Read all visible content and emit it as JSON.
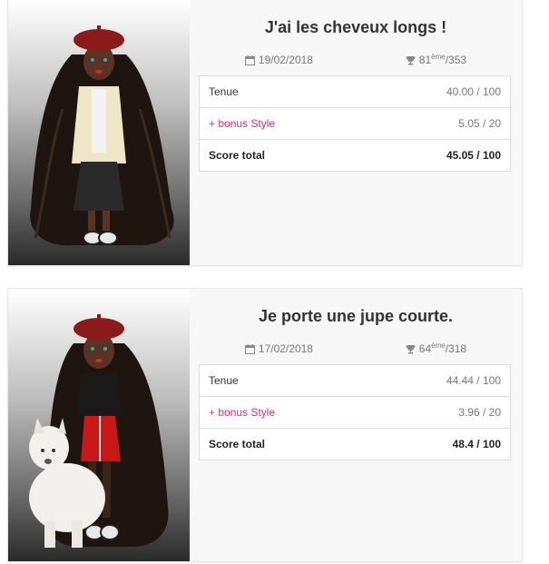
{
  "entries": [
    {
      "title": "J'ai les cheveux longs !",
      "date": "19/02/2018",
      "rank": "81",
      "rank_suffix": "ème",
      "rank_total": "/353",
      "rows": {
        "outfit_label": "Tenue",
        "outfit_value": "40.00 / 100",
        "bonus_label": "+ bonus Style",
        "bonus_value": "5.05 / 20",
        "total_label": "Score total",
        "total_value": "45.05 / 100"
      },
      "avatar": "girl-avatar-long-hair-cream-jacket"
    },
    {
      "title": "Je porte une jupe courte.",
      "date": "17/02/2018",
      "rank": "64",
      "rank_suffix": "ème",
      "rank_total": "/318",
      "rows": {
        "outfit_label": "Tenue",
        "outfit_value": "44.44 / 100",
        "bonus_label": "+ bonus Style",
        "bonus_value": "3.96 / 20",
        "total_label": "Score total",
        "total_value": "48.4 / 100"
      },
      "avatar": "girl-avatar-red-skirt-white-dog"
    }
  ],
  "colors": {
    "bonus": "#e0297a",
    "card_bg": "#f7f7f7",
    "beret": "#8b1a1a"
  },
  "icons": [
    "calendar-icon",
    "trophy-icon"
  ]
}
